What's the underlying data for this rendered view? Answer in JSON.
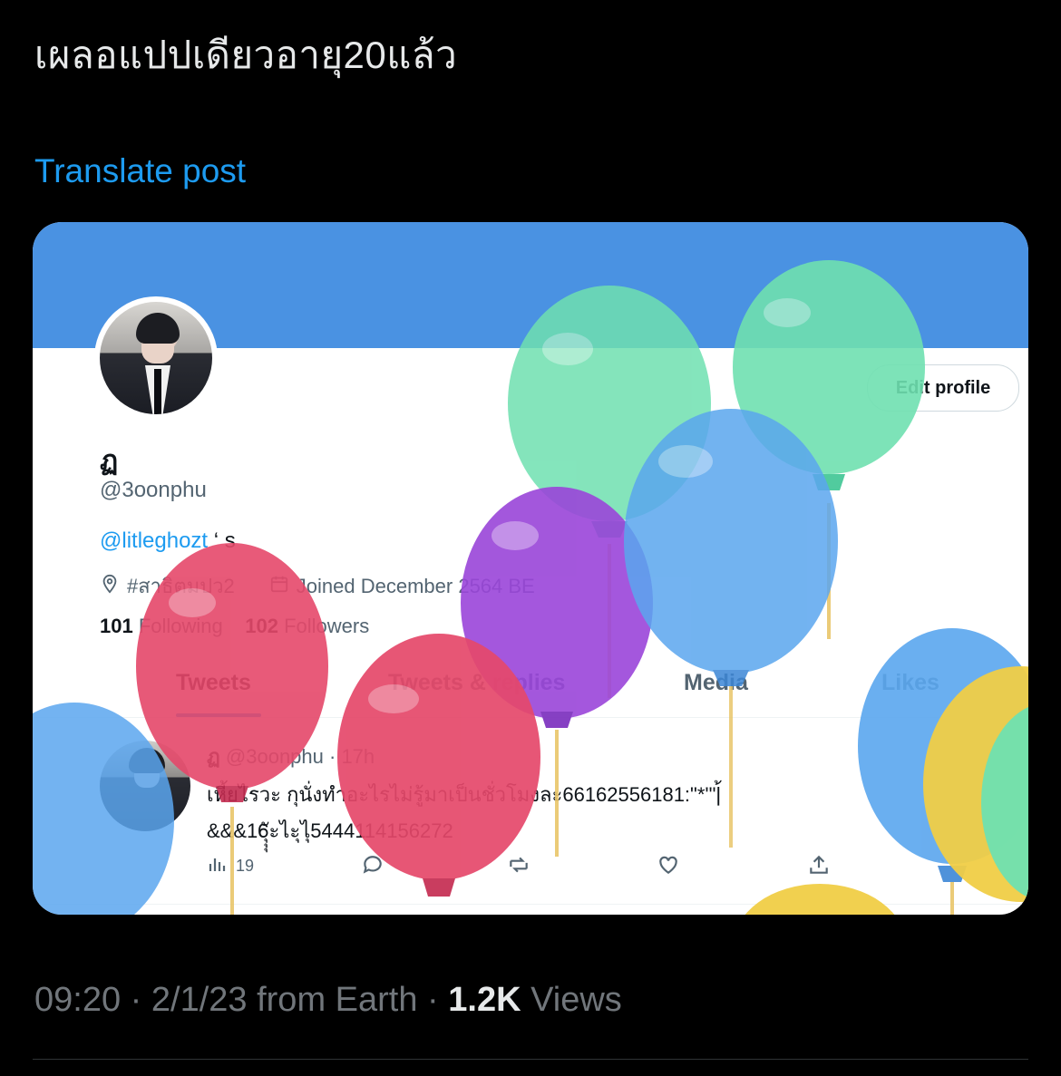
{
  "tweet": {
    "text": "เผลอแปปเดียวอายุ20แล้ว",
    "translate_label": "Translate post",
    "time": "09:20",
    "date": "2/1/23",
    "source": "from Earth",
    "views_count": "1.2K",
    "views_label": "Views"
  },
  "profile": {
    "display_name": "ฏ",
    "handle": "@3oonphu",
    "bio_mention": "@litleghozt",
    "bio_suffix": "‘ s",
    "location": "#สาธิตมปว2",
    "joined": "Joined December 2564 BE",
    "following_count": "101",
    "following_label": "Following",
    "followers_count": "102",
    "followers_label": "Followers",
    "edit_profile_label": "Edit profile",
    "tabs": [
      "Tweets",
      "Tweets & replies",
      "Media",
      "Likes"
    ]
  },
  "inner_tweet": {
    "name": "ฏ",
    "handle_time": "@3oonphu · 17h",
    "line1": "เหี้ยไรวะ กุนั่งทำอะไรไม่รู้มาเป็นชั่วโมงละ66162556181:\"*'\"|้",
    "line2": "&&&16ุุุัะไะุไุ5444114156272",
    "views": "19"
  },
  "colors": {
    "banner": "#4a92e2",
    "link": "#1d9bf0",
    "balloon_green": "#6fe0b0",
    "balloon_blue": "#5aa6ee",
    "balloon_purple": "#9a45d9",
    "balloon_red": "#e5486a",
    "balloon_yellow": "#f0cd46"
  }
}
